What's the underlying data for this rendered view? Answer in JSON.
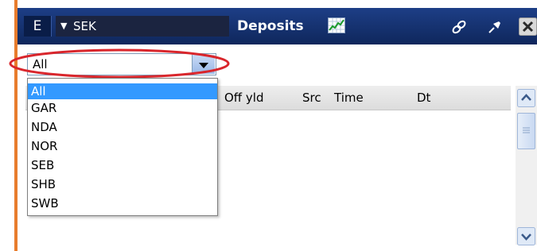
{
  "window": {
    "code_button": "E",
    "currency": "SEK",
    "title": "Deposits"
  },
  "filter": {
    "selected": "All",
    "options": [
      "All",
      "GAR",
      "NDA",
      "NOR",
      "SEB",
      "SHB",
      "SWB"
    ]
  },
  "columns": {
    "c0": "(",
    "off_yld": "Off yld",
    "src": "Src",
    "time": "Time",
    "dt": "Dt"
  },
  "icons": {
    "chart": "chart-icon",
    "link": "link-icon",
    "pin": "pin-icon",
    "close": "close-icon",
    "dropdown": "chevron-down-icon"
  },
  "colors": {
    "titlebar": "#14306a",
    "frame": "#e87c2c",
    "highlight": "#d9262c",
    "selection": "#3399ff"
  }
}
